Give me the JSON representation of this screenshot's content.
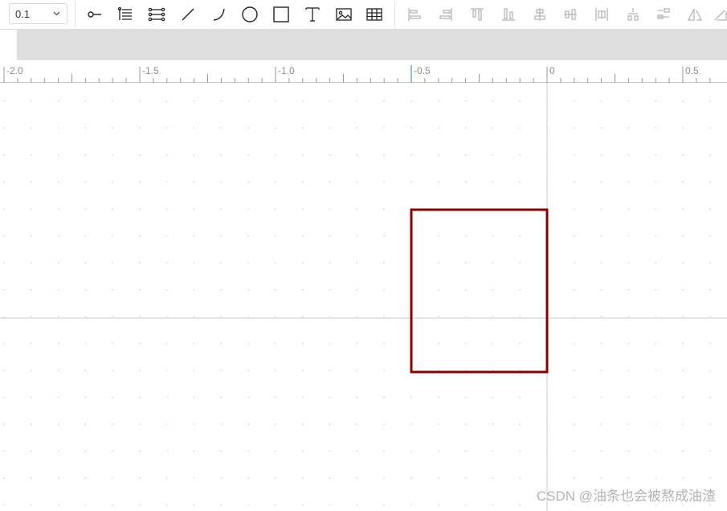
{
  "toolbar": {
    "zoom": {
      "value": "0.1"
    },
    "tools": [
      {
        "name": "connector-point-icon"
      },
      {
        "name": "list-tree-icon"
      },
      {
        "name": "list-tree-double-icon"
      },
      {
        "name": "line-icon"
      },
      {
        "name": "arc-icon"
      },
      {
        "name": "circle-icon"
      },
      {
        "name": "rectangle-icon"
      },
      {
        "name": "text-icon"
      },
      {
        "name": "image-icon"
      },
      {
        "name": "table-icon"
      }
    ],
    "align_tools": [
      {
        "name": "align-left-icon"
      },
      {
        "name": "align-right-icon"
      },
      {
        "name": "align-top-icon"
      },
      {
        "name": "align-bottom-icon"
      },
      {
        "name": "align-center-horizontal-icon"
      },
      {
        "name": "align-center-vertical-icon"
      },
      {
        "name": "distribute-horizontal-icon"
      },
      {
        "name": "distribute-vertical-icon"
      },
      {
        "name": "distribute-center-icon"
      },
      {
        "name": "flip-horizontal-icon"
      },
      {
        "name": "flip-vertical-icon"
      }
    ]
  },
  "ruler": {
    "labels": [
      "-2.0",
      "-1.5",
      "-1.0",
      "-0.5",
      "0",
      "0.5"
    ],
    "label_values": [
      -2.0,
      -1.5,
      -1.0,
      -0.5,
      0,
      0.5
    ],
    "marker_value": -0.5
  },
  "canvas": {
    "shape": {
      "type": "rectangle",
      "x_from": -0.5,
      "x_to": 0.0,
      "stroke": "#8b0000"
    }
  },
  "colors": {
    "shape_stroke": "#8b0000",
    "axis_line": "#cccccc",
    "grid_dot": "#d4d4d4",
    "ruler_marker": "#4a90d9"
  },
  "watermark": {
    "text": "CSDN @油条也会被熬成油渣"
  }
}
